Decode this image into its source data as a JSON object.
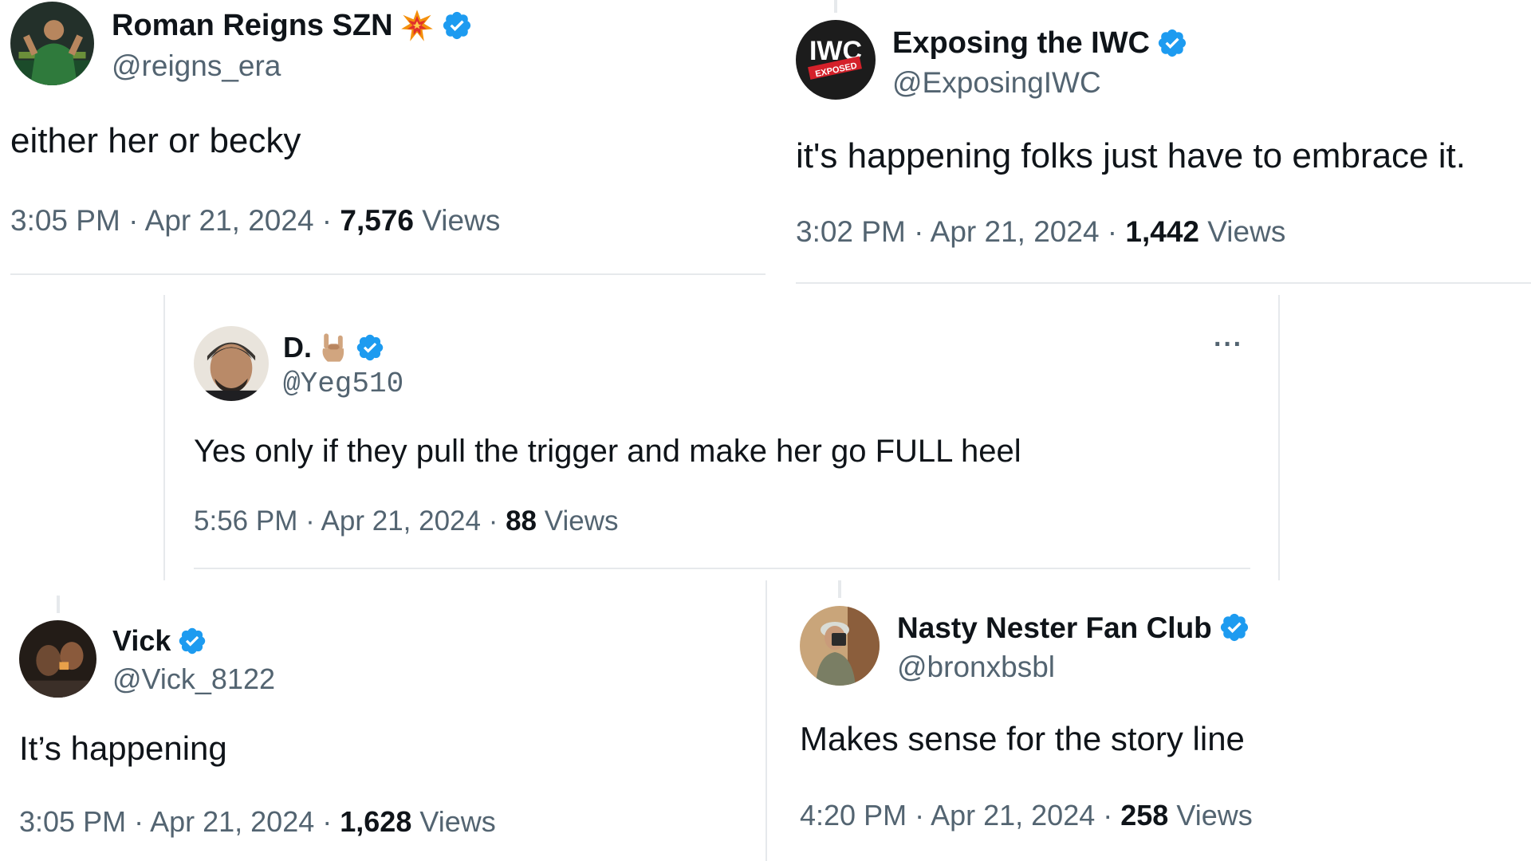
{
  "colors": {
    "verified": "#1d9bf0",
    "text": "#0f1419",
    "muted": "#536471"
  },
  "tweets": [
    {
      "name": "Roman Reigns SZN",
      "handle": "@reigns_era",
      "text": "either her or becky",
      "time": "3:05 PM",
      "date": "Apr 21, 2024",
      "views_count": "7,576",
      "views_label": "Views",
      "emoji": "collision-emoji",
      "verified": true
    },
    {
      "name": "Exposing the IWC",
      "handle": "@ExposingIWC",
      "text": "it's happening folks just have to embrace it.",
      "time": "3:02 PM",
      "date": "Apr 21, 2024",
      "views_count": "1,442",
      "views_label": "Views",
      "avatar_logo_text": "IWC EXPOSED",
      "verified": true
    },
    {
      "name": "D.",
      "handle": "@Yeg510",
      "text": "Yes only if they pull the trigger and make her go FULL heel",
      "time": "5:56 PM",
      "date": "Apr 21, 2024",
      "views_count": "88",
      "views_label": "Views",
      "emoji": "sign-of-horns-emoji",
      "more_label": "···",
      "verified": true
    },
    {
      "name": "Vick",
      "handle": "@Vick_8122",
      "text": "It’s happening",
      "time": "3:05 PM",
      "date": "Apr 21, 2024",
      "views_count": "1,628",
      "views_label": "Views",
      "verified": true
    },
    {
      "name": "Nasty Nester Fan Club",
      "handle": "@bronxbsbl",
      "text": "Makes sense for the story line",
      "time": "4:20 PM",
      "date": "Apr 21, 2024",
      "views_count": "258",
      "views_label": "Views",
      "verified": true
    }
  ],
  "separator": " · "
}
